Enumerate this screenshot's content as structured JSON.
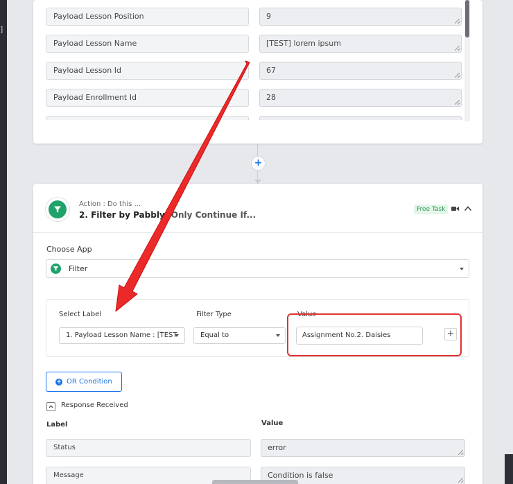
{
  "top_fields": [
    {
      "label": "Payload Lesson Position",
      "value": "9"
    },
    {
      "label": "Payload Lesson Name",
      "value": "[TEST] lorem ipsum"
    },
    {
      "label": "Payload Lesson Id",
      "value": "67"
    },
    {
      "label": "Payload Enrollment Id",
      "value": "28"
    }
  ],
  "action": {
    "subtitle": "Action : Do this ...",
    "step": "2. Filter by Pabbly:",
    "step_suffix": "Only Continue If...",
    "badge": "Free Task",
    "icons": {
      "badge": "filter-funnel-icon",
      "video": "video-camera-icon",
      "collapse": "chevron-up-icon",
      "add_step": "plus-icon"
    }
  },
  "choose_app": {
    "label": "Choose App",
    "selected": "Filter"
  },
  "filter": {
    "select_label_heading": "Select Label",
    "select_label_value": "1. Payload Lesson Name : [TEST",
    "filter_type_heading": "Filter Type",
    "filter_type_value": "Equal to",
    "value_heading": "Value",
    "value": "Assignment No.2. Daisies",
    "add_symbol": "+"
  },
  "or_condition": {
    "label": "OR Condition",
    "icon_symbol": "+"
  },
  "response": {
    "title": "Response Received",
    "label_header": "Label",
    "value_header": "Value",
    "rows": [
      {
        "label": "Status",
        "value": "error"
      },
      {
        "label": "Message",
        "value": "Condition is false"
      }
    ]
  },
  "colors": {
    "accent": "#1a73e8",
    "brand_green": "#1fa36a",
    "annotation_red": "#e03131"
  }
}
